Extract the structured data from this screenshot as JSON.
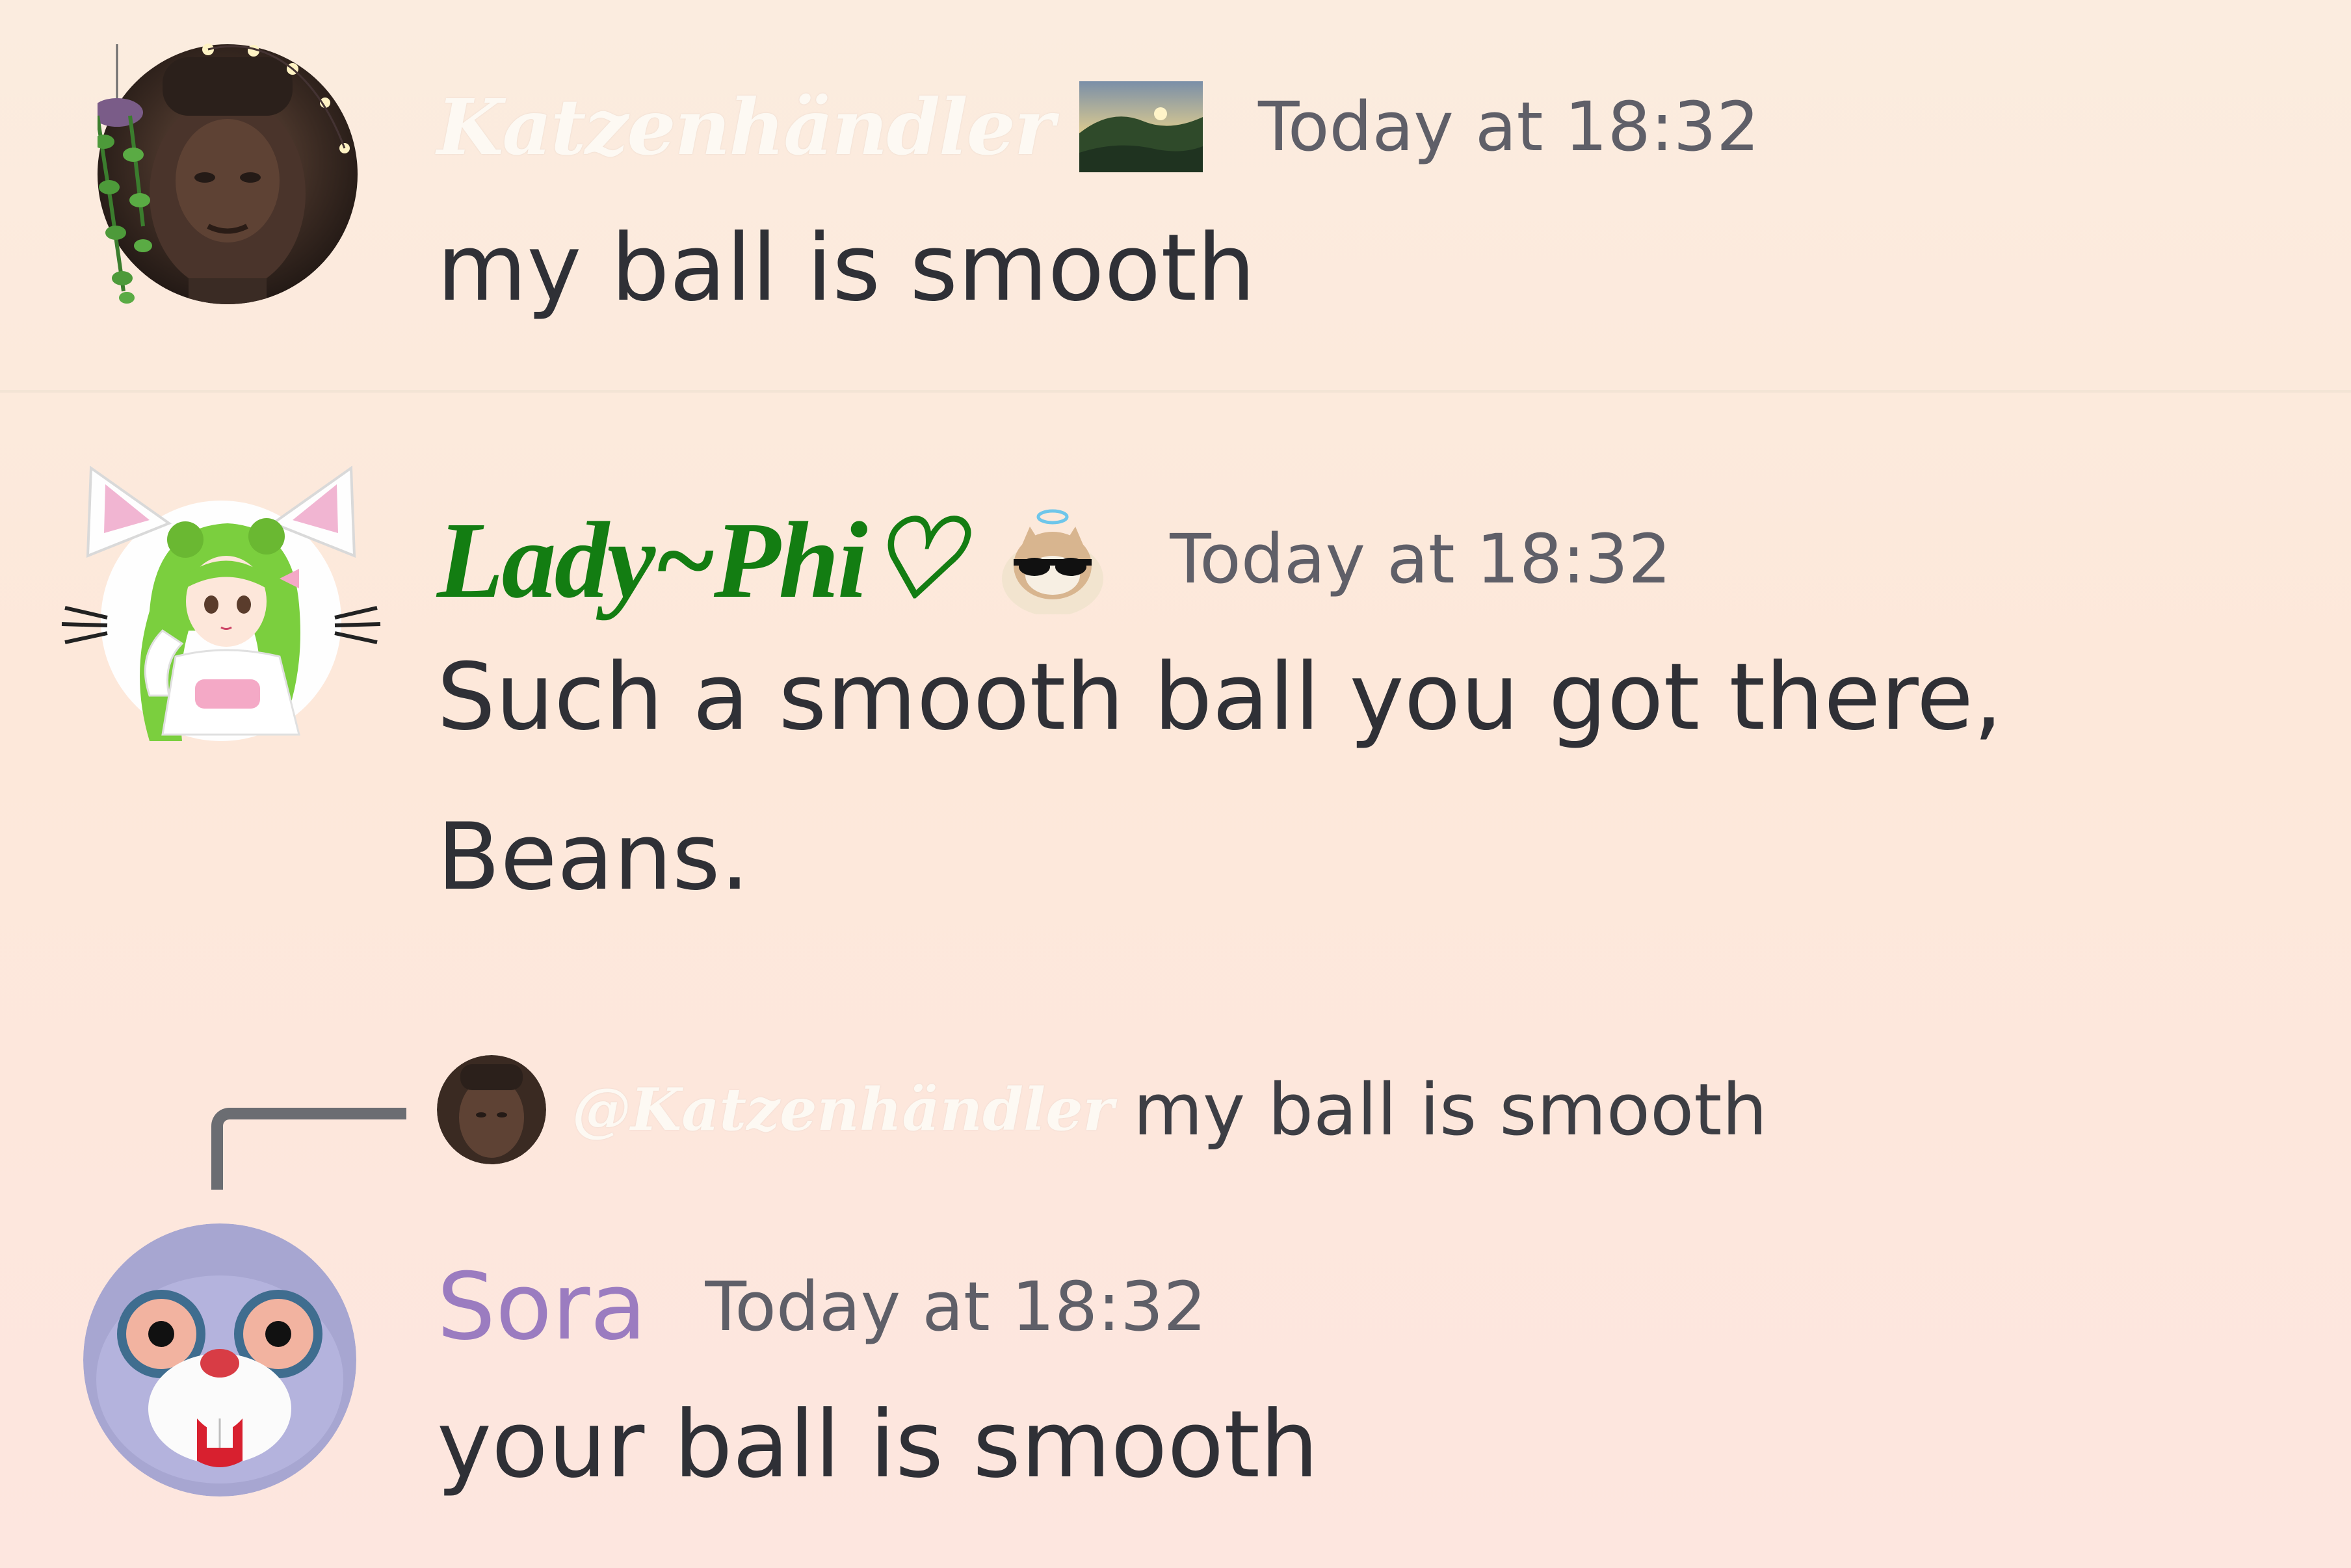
{
  "messages": [
    {
      "author": "Katzenhändler",
      "timestamp": "Today at 18:32",
      "text": "my ball is smooth",
      "badge_icon": "landscape-photo-icon",
      "avatar_icon": "dark-portrait-with-plant-frame"
    },
    {
      "author": "Lady~Phi♡",
      "timestamp": "Today at 18:32",
      "text_line1": "Such a smooth ball you got there,",
      "text_line2": "Beans.",
      "badge_icon": "cat-with-sunglasses-icon",
      "avatar_icon": "green-haired-anime-cat-ears"
    },
    {
      "author": "Sora",
      "timestamp": "Today at 18:32",
      "text": "your ball is smooth",
      "avatar_icon": "plush-bunny-face",
      "reply": {
        "mention": "@Katzenhändler",
        "text": "my ball is smooth"
      }
    }
  ],
  "colors": {
    "phi_name": "#137d12",
    "sora_name": "#9b7cc0",
    "katz_name": "#fdf9f3",
    "message_text": "#2f3036",
    "timestamp": "#5f5f68"
  }
}
